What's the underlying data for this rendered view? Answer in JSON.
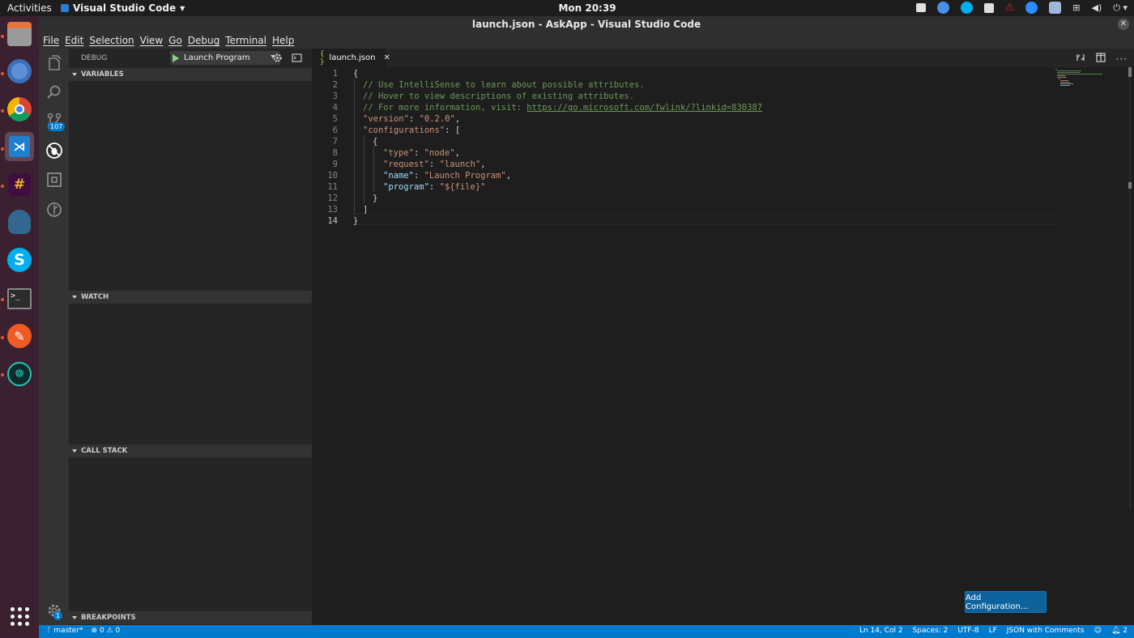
{
  "topbar": {
    "activities": "Activities",
    "app_name": "Visual Studio Code",
    "clock": "Mon 20:39"
  },
  "window": {
    "title": "launch.json - AskApp - Visual Studio Code"
  },
  "menu": [
    "File",
    "Edit",
    "Selection",
    "View",
    "Go",
    "Debug",
    "Terminal",
    "Help"
  ],
  "activitybar": {
    "scm_badge": "107",
    "settings_badge": "1"
  },
  "sidebar": {
    "title": "DEBUG",
    "config_select": "Launch Program",
    "sections": {
      "variables": "VARIABLES",
      "watch": "WATCH",
      "call_stack": "CALL STACK",
      "breakpoints": "BREAKPOINTS"
    }
  },
  "editor": {
    "tab_label": "launch.json",
    "tab_icon": "{ }",
    "lines": [
      {
        "n": "1",
        "text": "{"
      },
      {
        "n": "2",
        "text": "// Use IntelliSense to learn about possible attributes."
      },
      {
        "n": "3",
        "text": "// Hover to view descriptions of existing attributes."
      },
      {
        "n": "4",
        "text": "// For more information, visit: ",
        "link": "https://go.microsoft.com/fwlink/?linkid=830387"
      },
      {
        "n": "5",
        "key": "\"version\"",
        "sep": ": ",
        "val": "\"0.2.0\"",
        "end": ","
      },
      {
        "n": "6",
        "key": "\"configurations\"",
        "sep": ": ",
        "val": "",
        "end": "["
      },
      {
        "n": "7",
        "text": "{"
      },
      {
        "n": "8",
        "key": "\"type\"",
        "sep": ": ",
        "val": "\"node\"",
        "end": ","
      },
      {
        "n": "9",
        "key": "\"request\"",
        "sep": ": ",
        "val": "\"launch\"",
        "end": ","
      },
      {
        "n": "10",
        "key": "\"name\"",
        "sep": ": ",
        "val": "\"Launch Program\"",
        "end": ","
      },
      {
        "n": "11",
        "key": "\"program\"",
        "sep": ": ",
        "val": "\"${file}\"",
        "end": ""
      },
      {
        "n": "12",
        "text": "}"
      },
      {
        "n": "13",
        "text": "]"
      },
      {
        "n": "14",
        "text": "}"
      }
    ],
    "add_config_button": "Add Configuration..."
  },
  "statusbar": {
    "branch": "master*",
    "errors": "0",
    "warnings": "0",
    "position": "Ln 14, Col 2",
    "spaces": "Spaces: 2",
    "encoding": "UTF-8",
    "eol": "LF",
    "language": "JSON with Comments",
    "notifications": "2"
  },
  "colors": {
    "accent": "#007acc",
    "dock": "#3b2130",
    "button": "#0e639c"
  }
}
